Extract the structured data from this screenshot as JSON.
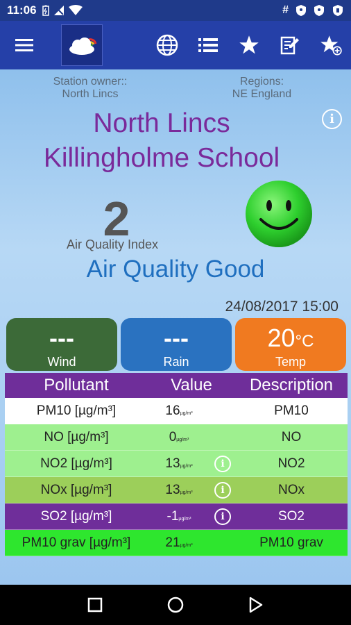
{
  "status_bar": {
    "time": "11:06",
    "right_glyph": "#"
  },
  "app_bar": {
    "icons": [
      "menu-icon",
      "globe-icon",
      "list-icon",
      "star-icon",
      "edit-note-icon",
      "star-add-icon"
    ]
  },
  "station": {
    "owner_label": "Station owner::",
    "owner_value": "North Lincs",
    "regions_label": "Regions:",
    "regions_value": "NE England",
    "name_line1": "North Lincs",
    "name_line2": "Killingholme School"
  },
  "air_quality": {
    "index_value": "2",
    "index_label": "Air Quality Index",
    "status": "Air Quality Good",
    "timestamp": "24/08/2017 15:00"
  },
  "tiles": {
    "wind": {
      "value": "---",
      "label": "Wind"
    },
    "rain": {
      "value": "---",
      "label": "Rain"
    },
    "temp": {
      "value": "20",
      "unit": "°C",
      "label": "Temp"
    }
  },
  "table": {
    "headers": {
      "pollutant": "Pollutant",
      "value": "Value",
      "description": "Description"
    },
    "rows": [
      {
        "pollutant": "PM10 [µg/m³]",
        "value": "16",
        "unit": "µg/m³",
        "description": "PM10",
        "info": false,
        "color": "#ffffff"
      },
      {
        "pollutant": "NO [µg/m³]",
        "value": "0",
        "unit": "µg/m³",
        "description": "NO",
        "info": false,
        "color": "#9ef08f"
      },
      {
        "pollutant": "NO2 [µg/m³]",
        "value": "13",
        "unit": "µg/m³",
        "description": "NO2",
        "info": true,
        "color": "#9ef08f"
      },
      {
        "pollutant": "NOx [µg/m³]",
        "value": "13",
        "unit": "µg/m³",
        "description": "NOx",
        "info": true,
        "color": "#9ccf5a"
      },
      {
        "pollutant": "SO2 [µg/m³]",
        "value": "-1",
        "unit": "µg/m³",
        "description": "SO2",
        "info": true,
        "color": "#6f2e9a"
      },
      {
        "pollutant": "PM10 grav [µg/m³]",
        "value": "21",
        "unit": "µg/m³",
        "description": "PM10 grav",
        "info": false,
        "color": "#2ee62e"
      }
    ]
  },
  "colors": {
    "app_bar": "#2540a8",
    "title": "#7a2a9a",
    "status_good": "#1f6fbf"
  }
}
